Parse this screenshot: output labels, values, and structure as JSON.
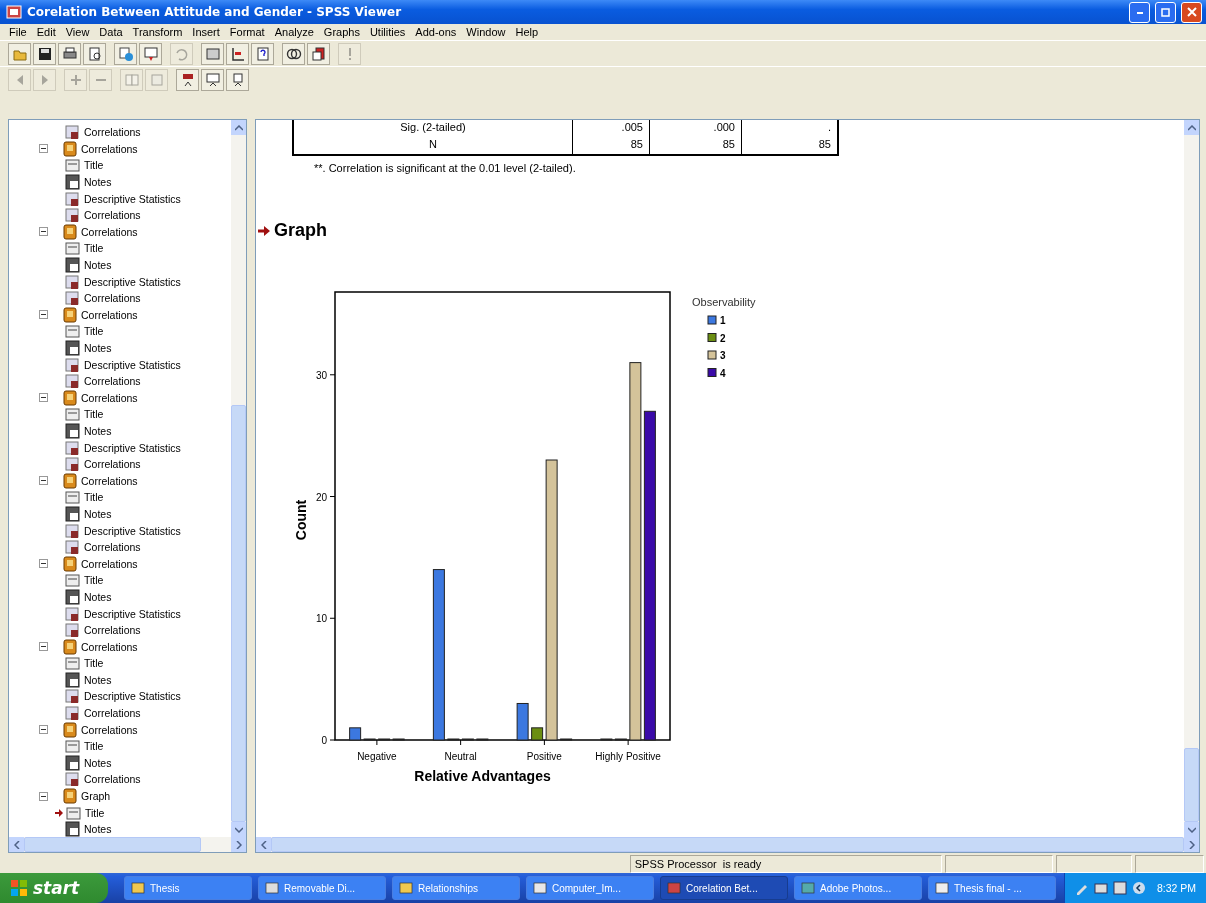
{
  "window": {
    "title": "Corelation Between Attitude and Gender - SPSS Viewer"
  },
  "menu": [
    "File",
    "Edit",
    "View",
    "Data",
    "Transform",
    "Insert",
    "Format",
    "Analyze",
    "Graphs",
    "Utilities",
    "Add-ons",
    "Window",
    "Help"
  ],
  "toolbars": [
    [
      {
        "disabled": false
      },
      {
        "disabled": false
      },
      {
        "disabled": false
      },
      {
        "disabled": false
      },
      {
        "disabled": false
      },
      {
        "disabled": false
      },
      {
        "disabled": true
      },
      {
        "disabled": false
      },
      {
        "disabled": false
      },
      {
        "disabled": false
      },
      {
        "disabled": false
      },
      {
        "disabled": false
      },
      {
        "disabled": true
      }
    ],
    [
      {
        "disabled": true
      },
      {
        "disabled": true
      },
      {
        "disabled": true
      },
      {
        "disabled": true
      },
      {
        "disabled": true
      },
      {
        "disabled": true
      },
      {
        "disabled": false
      },
      {
        "disabled": false
      },
      {
        "disabled": false
      }
    ]
  ],
  "outline": {
    "items": [
      {
        "label": "Correlations",
        "kind": "table",
        "current": false
      },
      {
        "label": "Correlations",
        "kind": "group",
        "expanded": true,
        "children": [
          {
            "label": "Title",
            "kind": "title",
            "current": false
          },
          {
            "label": "Notes",
            "kind": "notes",
            "current": false
          },
          {
            "label": "Descriptive Statistics",
            "kind": "table",
            "current": false
          },
          {
            "label": "Correlations",
            "kind": "table",
            "current": false
          }
        ]
      },
      {
        "label": "Correlations",
        "kind": "group",
        "expanded": true,
        "children": [
          {
            "label": "Title",
            "kind": "title",
            "current": false
          },
          {
            "label": "Notes",
            "kind": "notes",
            "current": false
          },
          {
            "label": "Descriptive Statistics",
            "kind": "table",
            "current": false
          },
          {
            "label": "Correlations",
            "kind": "table",
            "current": false
          }
        ]
      },
      {
        "label": "Correlations",
        "kind": "group",
        "expanded": true,
        "children": [
          {
            "label": "Title",
            "kind": "title",
            "current": false
          },
          {
            "label": "Notes",
            "kind": "notes",
            "current": false
          },
          {
            "label": "Descriptive Statistics",
            "kind": "table",
            "current": false
          },
          {
            "label": "Correlations",
            "kind": "table",
            "current": false
          }
        ]
      },
      {
        "label": "Correlations",
        "kind": "group",
        "expanded": true,
        "children": [
          {
            "label": "Title",
            "kind": "title",
            "current": false
          },
          {
            "label": "Notes",
            "kind": "notes",
            "current": false
          },
          {
            "label": "Descriptive Statistics",
            "kind": "table",
            "current": false
          },
          {
            "label": "Correlations",
            "kind": "table",
            "current": false
          }
        ]
      },
      {
        "label": "Correlations",
        "kind": "group",
        "expanded": true,
        "children": [
          {
            "label": "Title",
            "kind": "title",
            "current": false
          },
          {
            "label": "Notes",
            "kind": "notes",
            "current": false
          },
          {
            "label": "Descriptive Statistics",
            "kind": "table",
            "current": false
          },
          {
            "label": "Correlations",
            "kind": "table",
            "current": false
          }
        ]
      },
      {
        "label": "Correlations",
        "kind": "group",
        "expanded": true,
        "children": [
          {
            "label": "Title",
            "kind": "title",
            "current": false
          },
          {
            "label": "Notes",
            "kind": "notes",
            "current": false
          },
          {
            "label": "Descriptive Statistics",
            "kind": "table",
            "current": false
          },
          {
            "label": "Correlations",
            "kind": "table",
            "current": false
          }
        ]
      },
      {
        "label": "Correlations",
        "kind": "group",
        "expanded": true,
        "children": [
          {
            "label": "Title",
            "kind": "title",
            "current": false
          },
          {
            "label": "Notes",
            "kind": "notes",
            "current": false
          },
          {
            "label": "Descriptive Statistics",
            "kind": "table",
            "current": false
          },
          {
            "label": "Correlations",
            "kind": "table",
            "current": false
          }
        ]
      },
      {
        "label": "Correlations",
        "kind": "group",
        "expanded": true,
        "children": [
          {
            "label": "Title",
            "kind": "title",
            "current": false
          },
          {
            "label": "Notes",
            "kind": "notes",
            "current": false
          },
          {
            "label": "Correlations",
            "kind": "table",
            "current": false
          }
        ]
      },
      {
        "label": "Graph",
        "kind": "group",
        "expanded": true,
        "children": [
          {
            "label": "Title",
            "kind": "title",
            "current": true
          },
          {
            "label": "Notes",
            "kind": "notes",
            "current": false
          }
        ]
      }
    ]
  },
  "output": {
    "table": {
      "rows": [
        {
          "label": "Sig. (2-tailed)",
          "cells": [
            ".005",
            ".000",
            "."
          ]
        },
        {
          "label": "N",
          "cells": [
            "85",
            "85",
            "85"
          ]
        }
      ]
    },
    "footnote": "**. Correlation is significant at the 0.01 level (2-tailed).",
    "heading": "Graph",
    "chart_data": {
      "type": "bar",
      "xlabel": "Relative Advantages",
      "ylabel": "Count",
      "legend": {
        "title": "Observability"
      },
      "categories": [
        "Negative",
        "Neutral",
        "Positive",
        "Highly Positive"
      ],
      "series": [
        {
          "name": "1",
          "color": "#3c78e0",
          "values": [
            1,
            14,
            3,
            0
          ]
        },
        {
          "name": "2",
          "color": "#6b8e12",
          "values": [
            0,
            0,
            1,
            0
          ]
        },
        {
          "name": "3",
          "color": "#d4c39a",
          "values": [
            0,
            0,
            23,
            31
          ]
        },
        {
          "name": "4",
          "color": "#3a0aa8",
          "values": [
            0,
            0,
            0,
            27
          ]
        }
      ],
      "ylim": [
        0,
        36.8
      ],
      "yticks": [
        0,
        10,
        20,
        30
      ]
    }
  },
  "status_bar": {
    "message": "SPSS Processor  is ready"
  },
  "taskbar": {
    "start": "start",
    "tasks": [
      {
        "label": "Thesis",
        "kind": "folder",
        "selected": false
      },
      {
        "label": "Removable Di...",
        "kind": "drive",
        "selected": false
      },
      {
        "label": "Relationships",
        "kind": "folder",
        "selected": false
      },
      {
        "label": "Computer_Im...",
        "kind": "sheet",
        "selected": false
      },
      {
        "label": "Corelation Bet...",
        "kind": "spss",
        "selected": true
      },
      {
        "label": "Adobe Photos...",
        "kind": "photo",
        "selected": false
      },
      {
        "label": "Thesis final - ...",
        "kind": "doc",
        "selected": false
      }
    ],
    "clock": "8:32 PM"
  }
}
